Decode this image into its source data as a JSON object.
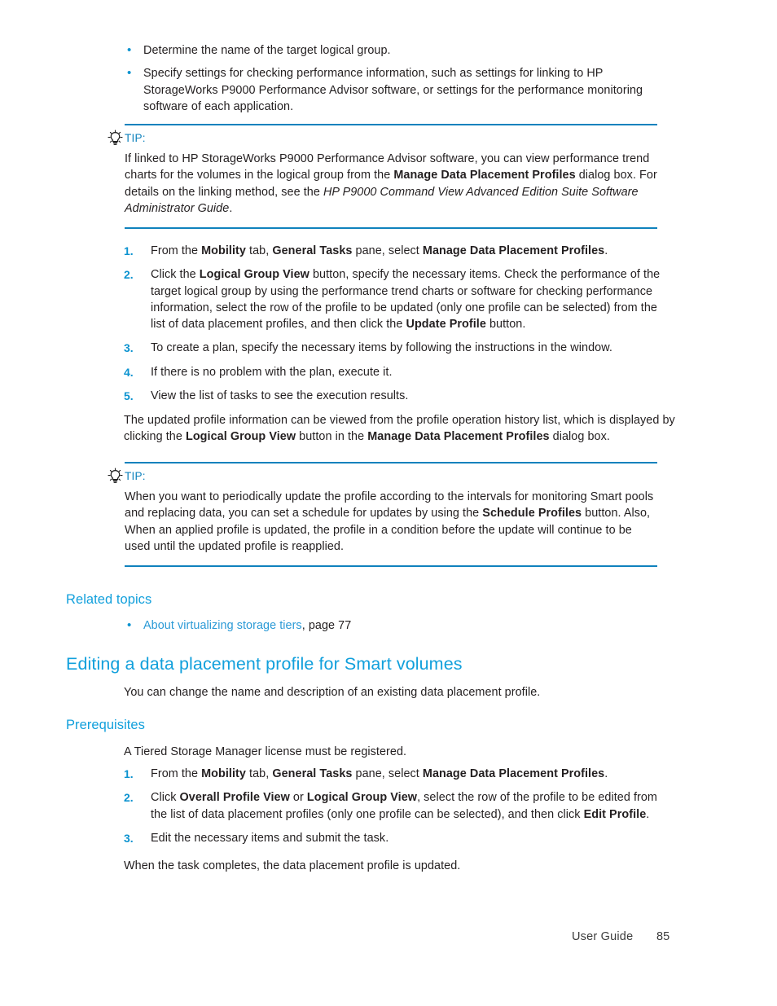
{
  "document": {
    "type": "user-guide-page",
    "page_number": "85",
    "footer_label": "User Guide",
    "accent_color": "#12a0dc",
    "rule_color": "#0f82bd",
    "link_color": "#2b9ad6",
    "list_marker_color": "#0c93d0",
    "body_color": "#231f20"
  },
  "intro_bullets": {
    "marker": "•",
    "items": [
      {
        "parts": [
          {
            "text": "Determine the name of the target logical group.",
            "style": "normal"
          }
        ]
      },
      {
        "parts": [
          {
            "text": "Specify settings for checking performance information, such as settings for linking to HP StorageWorks P9000 Performance Advisor software, or settings for the performance monitoring software of each application.",
            "style": "normal"
          }
        ]
      }
    ]
  },
  "tip_one": {
    "icon": "lightbulb-icon",
    "label": "TIP:",
    "parts": [
      {
        "text": "If linked to HP StorageWorks P9000 Performance Advisor software, you can view performance trend charts for the volumes in the logical group from the ",
        "style": "normal"
      },
      {
        "text": "Manage Data Placement Profiles",
        "style": "bold"
      },
      {
        "text": " dialog box. For details on the linking method, see the ",
        "style": "normal"
      },
      {
        "text": "HP P9000 Command View Advanced Edition Suite Software Administrator Guide",
        "style": "italic"
      },
      {
        "text": ".",
        "style": "normal"
      }
    ]
  },
  "steps_one": [
    {
      "number": "1.",
      "parts": [
        {
          "text": "From the ",
          "style": "normal"
        },
        {
          "text": "Mobility",
          "style": "bold"
        },
        {
          "text": " tab, ",
          "style": "normal"
        },
        {
          "text": "General Tasks",
          "style": "bold"
        },
        {
          "text": " pane, select ",
          "style": "normal"
        },
        {
          "text": "Manage Data Placement Profiles",
          "style": "bold"
        },
        {
          "text": ".",
          "style": "normal"
        }
      ]
    },
    {
      "number": "2.",
      "parts": [
        {
          "text": "Click the ",
          "style": "normal"
        },
        {
          "text": "Logical Group View",
          "style": "bold"
        },
        {
          "text": " button, specify the necessary items. Check the performance of the target logical group by using the performance trend charts or software for checking performance information, select the row of the profile to be updated (only one profile can be selected) from the list of data placement profiles, and then click the ",
          "style": "normal"
        },
        {
          "text": "Update Profile",
          "style": "bold"
        },
        {
          "text": " button.",
          "style": "normal"
        }
      ]
    },
    {
      "number": "3.",
      "parts": [
        {
          "text": "To create a plan, specify the necessary items by following the instructions in the window.",
          "style": "normal"
        }
      ]
    },
    {
      "number": "4.",
      "parts": [
        {
          "text": "If there is no problem with the plan, execute it.",
          "style": "normal"
        }
      ]
    },
    {
      "number": "5.",
      "parts": [
        {
          "text": "View the list of tasks to see the execution results.",
          "style": "normal"
        }
      ]
    }
  ],
  "para_one": {
    "parts": [
      {
        "text": "The updated profile information can be viewed from the profile operation history list, which is displayed by clicking the ",
        "style": "normal"
      },
      {
        "text": "Logical Group View",
        "style": "bold"
      },
      {
        "text": " button in the ",
        "style": "normal"
      },
      {
        "text": "Manage Data Placement Profiles",
        "style": "bold"
      },
      {
        "text": " dialog box.",
        "style": "normal"
      }
    ]
  },
  "tip_two": {
    "icon": "lightbulb-icon",
    "label": "TIP:",
    "parts": [
      {
        "text": "When you want to periodically update the profile according to the intervals for monitoring Smart pools and replacing data, you can set a schedule for updates by using the ",
        "style": "normal"
      },
      {
        "text": "Schedule Profiles",
        "style": "bold"
      },
      {
        "text": " button. Also, When an applied profile is updated, the profile in a condition before the update will continue to be used until the updated profile is reapplied.",
        "style": "normal"
      }
    ]
  },
  "related_topics": {
    "heading": "Related topics",
    "marker": "•",
    "items": [
      {
        "link_text": "About virtualizing storage tiers",
        "suffix": ", page 77"
      }
    ]
  },
  "section": {
    "heading": "Editing a data placement profile for Smart volumes",
    "intro": "You can change the name and description of an existing data placement profile.",
    "prereq_heading": "Prerequisites",
    "prereq_text": "A Tiered Storage Manager license must be registered.",
    "steps": [
      {
        "number": "1.",
        "parts": [
          {
            "text": "From the ",
            "style": "normal"
          },
          {
            "text": "Mobility",
            "style": "bold"
          },
          {
            "text": " tab, ",
            "style": "normal"
          },
          {
            "text": "General Tasks",
            "style": "bold"
          },
          {
            "text": " pane, select ",
            "style": "normal"
          },
          {
            "text": "Manage Data Placement Profiles",
            "style": "bold"
          },
          {
            "text": ".",
            "style": "normal"
          }
        ]
      },
      {
        "number": "2.",
        "parts": [
          {
            "text": "Click ",
            "style": "normal"
          },
          {
            "text": "Overall Profile View",
            "style": "bold"
          },
          {
            "text": " or ",
            "style": "normal"
          },
          {
            "text": "Logical Group View",
            "style": "bold"
          },
          {
            "text": ", select the row of the profile to be edited from the list of data placement profiles (only one profile can be selected), and then click ",
            "style": "normal"
          },
          {
            "text": "Edit Profile",
            "style": "bold"
          },
          {
            "text": ".",
            "style": "normal"
          }
        ]
      },
      {
        "number": "3.",
        "parts": [
          {
            "text": "Edit the necessary items and submit the task.",
            "style": "normal"
          }
        ]
      }
    ],
    "closing": "When the task completes, the data placement profile is updated."
  }
}
